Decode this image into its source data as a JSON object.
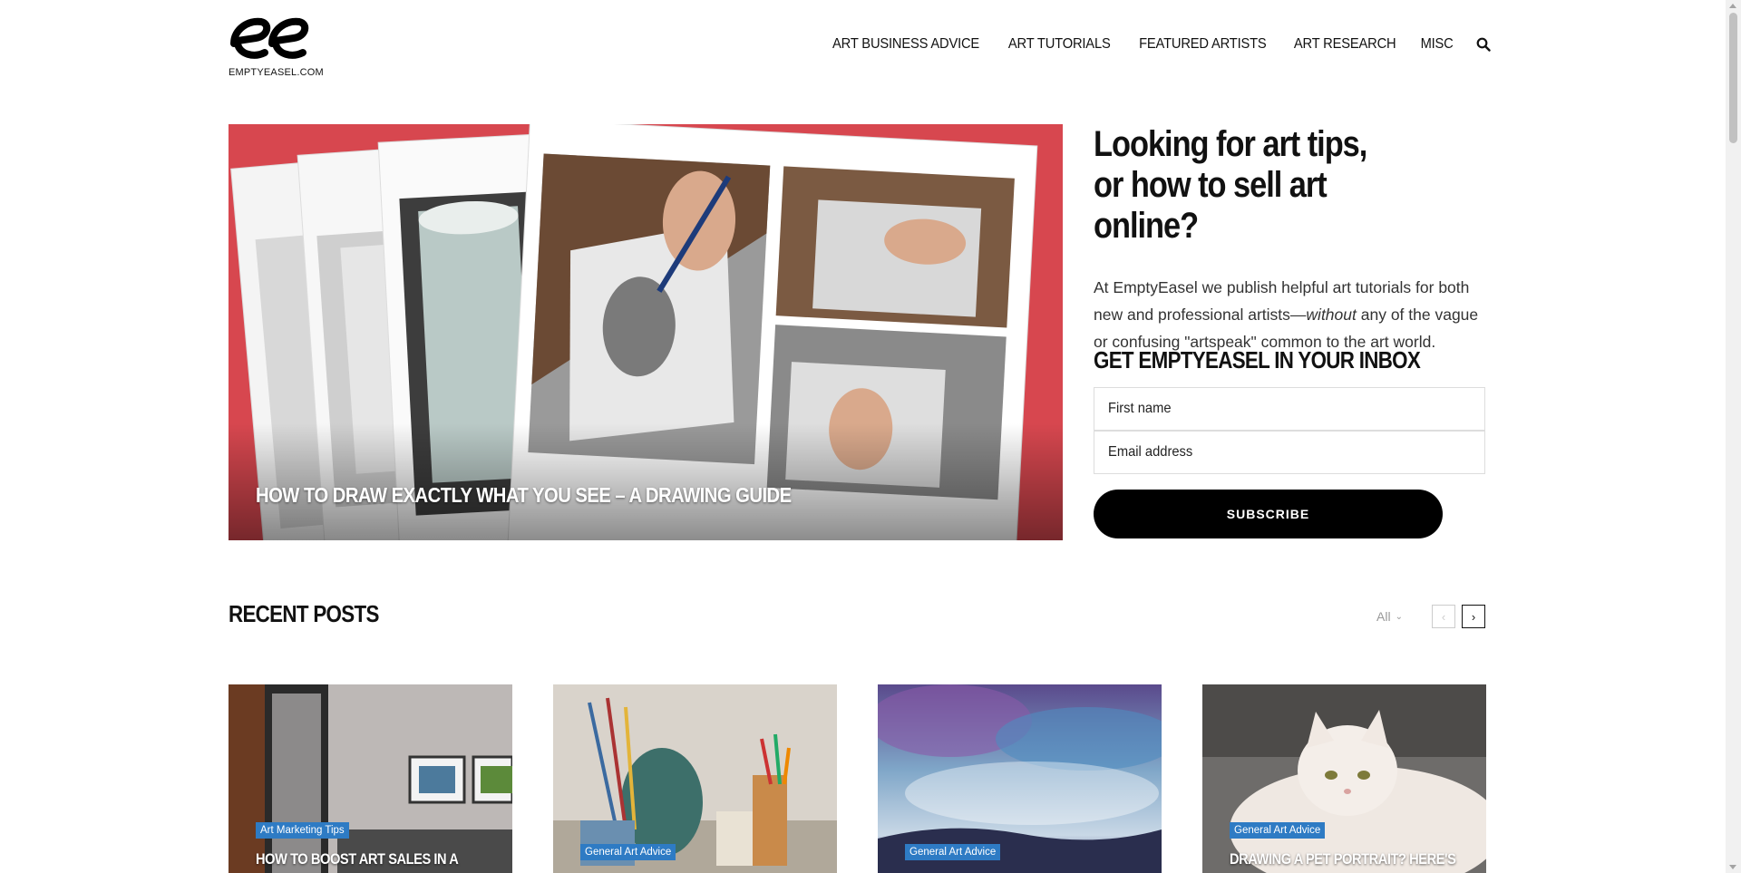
{
  "site": {
    "logo_text": "EMPTYEASEL.COM"
  },
  "nav": {
    "items": [
      "ART BUSINESS ADVICE",
      "ART TUTORIALS",
      "FEATURED ARTISTS",
      "ART RESEARCH",
      "MISC"
    ],
    "search_icon": "search-icon"
  },
  "hero": {
    "title": "HOW TO DRAW EXACTLY WHAT YOU SEE – A DRAWING GUIDE",
    "background": "#d7474f"
  },
  "intro": {
    "heading": "Looking for art tips, or how to sell art online?",
    "text_before": "At EmptyEasel we publish helpful art tutorials for both new and professional artists—",
    "text_em": "without",
    "text_after": " any of the vague or confusing \"artspeak\" common to the art world."
  },
  "signup": {
    "title": "GET EMPTYEASEL IN YOUR INBOX",
    "first_name_placeholder": "First name",
    "email_placeholder": "Email address",
    "button_label": "SUBSCRIBE"
  },
  "recent": {
    "title": "RECENT POSTS",
    "filter_label": "All",
    "prev_icon": "chevron-left-icon",
    "next_icon": "chevron-right-icon",
    "posts": [
      {
        "category": "Art Marketing Tips",
        "title": "HOW TO BOOST ART SALES IN A"
      },
      {
        "category": "General Art Advice",
        "title": ""
      },
      {
        "category": "General Art Advice",
        "title": ""
      },
      {
        "category": "General Art Advice",
        "title": "DRAWING A PET PORTRAIT? HERE'S"
      }
    ]
  },
  "colors": {
    "accent_badge": "#2e7bc4",
    "button": "#000000"
  }
}
